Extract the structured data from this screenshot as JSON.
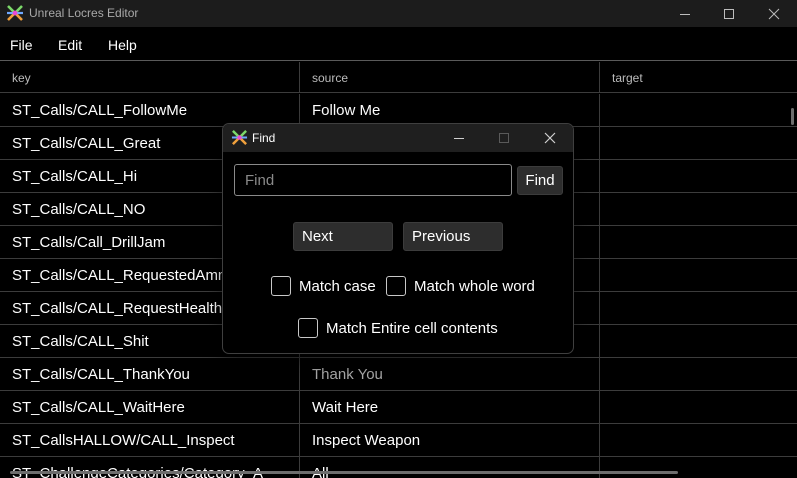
{
  "window": {
    "title": "Unreal Locres Editor",
    "icon": "app-icon"
  },
  "menu": {
    "file": "File",
    "edit": "Edit",
    "help": "Help"
  },
  "table": {
    "columns": [
      "key",
      "source",
      "target"
    ],
    "rows": [
      {
        "key": "ST_Calls/CALL_FollowMe",
        "source": "Follow Me",
        "target": ""
      },
      {
        "key": "ST_Calls/CALL_Great",
        "source": "",
        "target": ""
      },
      {
        "key": "ST_Calls/CALL_Hi",
        "source": "",
        "target": ""
      },
      {
        "key": "ST_Calls/CALL_NO",
        "source": "",
        "target": ""
      },
      {
        "key": "ST_Calls/Call_DrillJam",
        "source": "",
        "target": ""
      },
      {
        "key": "ST_Calls/CALL_RequestedAmmo",
        "source": "",
        "target": ""
      },
      {
        "key": "ST_Calls/CALL_RequestHealth",
        "source": "",
        "target": ""
      },
      {
        "key": "ST_Calls/CALL_Shit",
        "source": "",
        "target": ""
      },
      {
        "key": "ST_Calls/CALL_ThankYou",
        "source": "Thank You",
        "target": ""
      },
      {
        "key": "ST_Calls/CALL_WaitHere",
        "source": "Wait Here",
        "target": ""
      },
      {
        "key": "ST_CallsHALLOW/CALL_Inspect",
        "source": "Inspect Weapon",
        "target": ""
      },
      {
        "key": "ST_ChallengeCategories/Category_A",
        "source": "All",
        "target": ""
      }
    ]
  },
  "find_dialog": {
    "title": "Find",
    "search_placeholder": "Find",
    "search_value": "",
    "find_label": "Find",
    "next_label": "Next",
    "previous_label": "Previous",
    "match_case_label": "Match case",
    "match_whole_word_label": "Match whole word",
    "match_entire_cell_label": "Match Entire cell contents",
    "match_case_checked": false,
    "match_whole_word_checked": false,
    "match_entire_cell_checked": false
  },
  "colors": {
    "background": "#000000",
    "titlebar": "#1c1c1c",
    "grid_line": "#3c3c3c",
    "button_bg": "#2d2d2d"
  }
}
